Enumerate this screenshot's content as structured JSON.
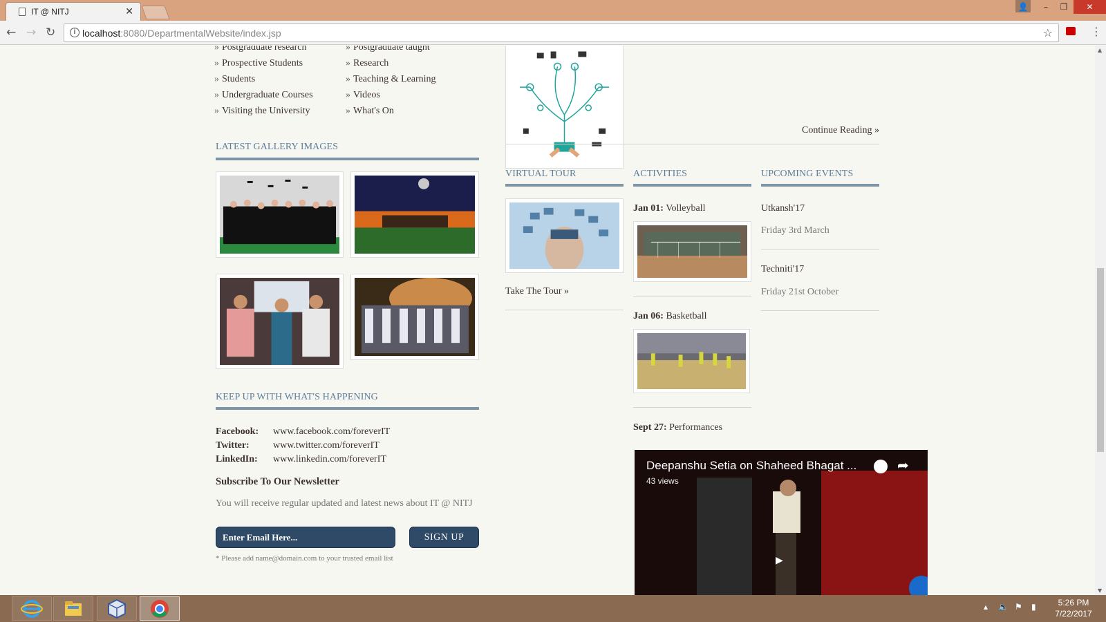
{
  "browser": {
    "tab_title": "IT @ NITJ",
    "tab_close": "✕",
    "url_host": "localhost",
    "url_rest": ":8080/DepartmentalWebsite/index.jsp"
  },
  "quick_links": {
    "col1": [
      "Postgraduate research",
      "Prospective Students",
      "Students",
      "Undergraduate Courses",
      "Visiting the University"
    ],
    "col2": [
      "Postgraduate taught",
      "Research",
      "Teaching & Learning",
      "Videos",
      "What's On"
    ],
    "bullet": "»"
  },
  "gallery": {
    "title": "LATEST GALLERY IMAGES"
  },
  "social": {
    "title": "KEEP UP WITH WHAT'S HAPPENING",
    "facebook_label": "Facebook:",
    "facebook_url": "www.facebook.com/foreverIT",
    "twitter_label": "Twitter:",
    "twitter_url": "www.twitter.com/foreverIT",
    "linkedin_label": "LinkedIn:",
    "linkedin_url": "www.linkedin.com/foreverIT"
  },
  "newsletter": {
    "title": "Subscribe To Our Newsletter",
    "description": "You will receive regular updated and latest news about IT @ NITJ",
    "email_placeholder": "Enter Email Here...",
    "signup_label": "SIGN UP",
    "note": "* Please add name@domain.com to your trusted email list"
  },
  "article": {
    "continue_reading": "Continue Reading »"
  },
  "virtual_tour": {
    "title": "VIRTUAL TOUR",
    "link": "Take The Tour »"
  },
  "activities": {
    "title": "ACTIVITIES",
    "items": [
      {
        "date": "Jan 01:",
        "name": "Volleyball"
      },
      {
        "date": "Jan 06:",
        "name": "Basketball"
      },
      {
        "date": "Sept 27:",
        "name": "Performances"
      }
    ]
  },
  "events": {
    "title": "UPCOMING EVENTS",
    "items": [
      {
        "name": "Utkansh'17",
        "date": "Friday 3rd March"
      },
      {
        "name": "Techniti'17",
        "date": "Friday 21st October"
      }
    ]
  },
  "video": {
    "title": "Deepanshu Setia on Shaheed Bhagat ...",
    "views": "43 views"
  },
  "taskbar": {
    "time": "5:26 PM",
    "date": "7/22/2017"
  }
}
